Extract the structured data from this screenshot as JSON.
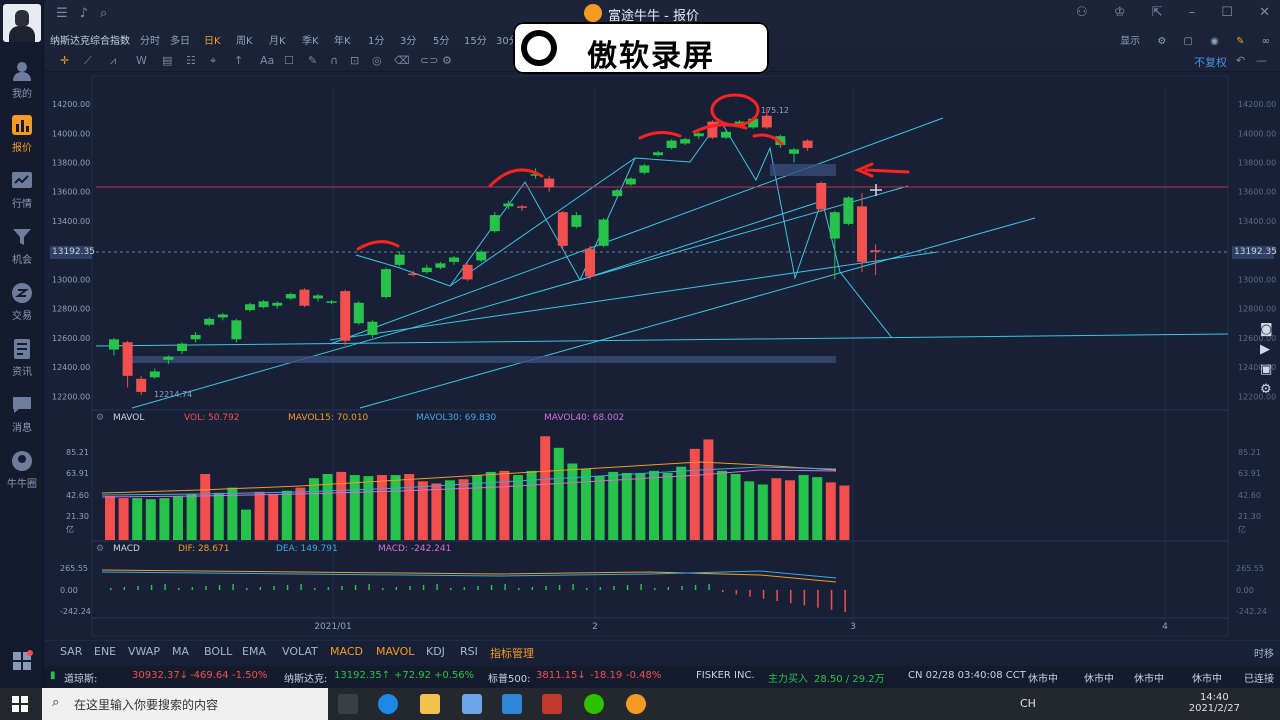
{
  "window": {
    "title": "富途牛牛 - 报价"
  },
  "sidebar": {
    "items": [
      {
        "label": "我的"
      },
      {
        "label": "报价"
      },
      {
        "label": "行情"
      },
      {
        "label": "机会"
      },
      {
        "label": "交易"
      },
      {
        "label": "资讯"
      },
      {
        "label": "消息"
      },
      {
        "label": "牛牛圈"
      }
    ]
  },
  "instrument": "纳斯达克综合指数",
  "periods": [
    "分时",
    "多日",
    "日K",
    "周K",
    "月K",
    "季K",
    "年K",
    "1分",
    "3分",
    "5分",
    "15分",
    "30分"
  ],
  "active_period": "日K",
  "view_options": {
    "display": "显示",
    "adjust": "不复权"
  },
  "watermark": "傲软录屏",
  "colors": {
    "up": "#26c24b",
    "down": "#f24f4f",
    "accent": "#f59a23",
    "trend": "#3ec3df",
    "annotation": "#ff2222"
  },
  "price_chart": {
    "y_ticks": [
      "14200.00",
      "14000.00",
      "13800.00",
      "13600.00",
      "13400.00",
      "13200.00",
      "13000.00",
      "12800.00",
      "12600.00",
      "12400.00",
      "12200.00"
    ],
    "current_price": "13192.35",
    "high_label": "175.12",
    "low_label": "12214.74"
  },
  "volume_panel": {
    "indicator": "MAVOL",
    "vol": "VOL: 50.792",
    "ma15": "MAVOL15: 70.010",
    "ma30": "MAVOL30: 69.830",
    "ma40": "MAVOL40: 68.002",
    "y_ticks": [
      "85.21",
      "63.91",
      "42.60",
      "21.30",
      "亿"
    ]
  },
  "macd_panel": {
    "indicator": "MACD",
    "dif": "DIF: 28.671",
    "dea": "DEA: 149.791",
    "macd": "MACD: -242.241",
    "y_ticks": [
      "265.55",
      "0.00",
      "-242.24"
    ]
  },
  "x_axis": [
    "2021/01",
    "2",
    "3",
    "4"
  ],
  "chart_data": {
    "type": "candlestick",
    "title": "纳斯达克综合指数",
    "candles": [
      {
        "o": 12520,
        "c": 12590,
        "h": 12600,
        "l": 12480
      },
      {
        "o": 12570,
        "c": 12340,
        "h": 12580,
        "l": 12260
      },
      {
        "o": 12320,
        "c": 12230,
        "h": 12340,
        "l": 12210
      },
      {
        "o": 12330,
        "c": 12370,
        "h": 12390,
        "l": 12320
      },
      {
        "o": 12450,
        "c": 12470,
        "h": 12480,
        "l": 12420
      },
      {
        "o": 12510,
        "c": 12560,
        "h": 12570,
        "l": 12490
      },
      {
        "o": 12590,
        "c": 12620,
        "h": 12640,
        "l": 12570
      },
      {
        "o": 12690,
        "c": 12730,
        "h": 12740,
        "l": 12680
      },
      {
        "o": 12740,
        "c": 12760,
        "h": 12770,
        "l": 12720
      },
      {
        "o": 12590,
        "c": 12720,
        "h": 12730,
        "l": 12570
      },
      {
        "o": 12790,
        "c": 12830,
        "h": 12840,
        "l": 12780
      },
      {
        "o": 12810,
        "c": 12850,
        "h": 12860,
        "l": 12800
      },
      {
        "o": 12820,
        "c": 12840,
        "h": 12850,
        "l": 12800
      },
      {
        "o": 12870,
        "c": 12900,
        "h": 12910,
        "l": 12860
      },
      {
        "o": 12930,
        "c": 12820,
        "h": 12940,
        "l": 12810
      },
      {
        "o": 12870,
        "c": 12890,
        "h": 12900,
        "l": 12850
      },
      {
        "o": 12840,
        "c": 12850,
        "h": 12860,
        "l": 12830
      },
      {
        "o": 12920,
        "c": 12580,
        "h": 12930,
        "l": 12550
      },
      {
        "o": 12700,
        "c": 12840,
        "h": 12850,
        "l": 12690
      },
      {
        "o": 12620,
        "c": 12710,
        "h": 12720,
        "l": 12600
      },
      {
        "o": 12880,
        "c": 13070,
        "h": 13080,
        "l": 12870
      },
      {
        "o": 13100,
        "c": 13170,
        "h": 13190,
        "l": 13090
      },
      {
        "o": 13040,
        "c": 13030,
        "h": 13060,
        "l": 13020
      },
      {
        "o": 13050,
        "c": 13080,
        "h": 13100,
        "l": 13040
      },
      {
        "o": 13080,
        "c": 13110,
        "h": 13120,
        "l": 13070
      },
      {
        "o": 13120,
        "c": 13150,
        "h": 13160,
        "l": 13100
      },
      {
        "o": 13100,
        "c": 13000,
        "h": 13110,
        "l": 12990
      },
      {
        "o": 13130,
        "c": 13190,
        "h": 13200,
        "l": 13120
      },
      {
        "o": 13330,
        "c": 13440,
        "h": 13460,
        "l": 13320
      },
      {
        "o": 13500,
        "c": 13520,
        "h": 13540,
        "l": 13480
      },
      {
        "o": 13500,
        "c": 13490,
        "h": 13510,
        "l": 13470
      },
      {
        "o": 13710,
        "c": 13720,
        "h": 13760,
        "l": 13690
      },
      {
        "o": 13690,
        "c": 13630,
        "h": 13710,
        "l": 13600
      },
      {
        "o": 13460,
        "c": 13230,
        "h": 13470,
        "l": 13210
      },
      {
        "o": 13360,
        "c": 13440,
        "h": 13460,
        "l": 13350
      },
      {
        "o": 13210,
        "c": 13020,
        "h": 13230,
        "l": 13000
      },
      {
        "o": 13230,
        "c": 13410,
        "h": 13420,
        "l": 13220
      },
      {
        "o": 13570,
        "c": 13610,
        "h": 13620,
        "l": 13560
      },
      {
        "o": 13650,
        "c": 13690,
        "h": 13700,
        "l": 13640
      },
      {
        "o": 13730,
        "c": 13780,
        "h": 13790,
        "l": 13720
      },
      {
        "o": 13850,
        "c": 13870,
        "h": 13880,
        "l": 13840
      },
      {
        "o": 13900,
        "c": 13950,
        "h": 13960,
        "l": 13890
      },
      {
        "o": 13930,
        "c": 13960,
        "h": 13970,
        "l": 13920
      },
      {
        "o": 13980,
        "c": 14000,
        "h": 14010,
        "l": 13960
      },
      {
        "o": 14080,
        "c": 13970,
        "h": 14090,
        "l": 13960
      },
      {
        "o": 13970,
        "c": 14010,
        "h": 14020,
        "l": 13960
      },
      {
        "o": 14050,
        "c": 14080,
        "h": 14090,
        "l": 14040
      },
      {
        "o": 14040,
        "c": 14100,
        "h": 14110,
        "l": 14030
      },
      {
        "o": 14120,
        "c": 14040,
        "h": 14175,
        "l": 14030
      },
      {
        "o": 13920,
        "c": 13980,
        "h": 13990,
        "l": 13900
      },
      {
        "o": 13860,
        "c": 13890,
        "h": 13900,
        "l": 13800
      },
      {
        "o": 13950,
        "c": 13900,
        "h": 13960,
        "l": 13880
      },
      {
        "o": 13660,
        "c": 13480,
        "h": 13670,
        "l": 13460
      },
      {
        "o": 13280,
        "c": 13460,
        "h": 13470,
        "l": 13000
      },
      {
        "o": 13380,
        "c": 13560,
        "h": 13570,
        "l": 13370
      },
      {
        "o": 13500,
        "c": 13120,
        "h": 13590,
        "l": 13050
      },
      {
        "o": 13200,
        "c": 13192,
        "h": 13240,
        "l": 13030
      }
    ],
    "volume": [
      {
        "v": 42,
        "up": false
      },
      {
        "v": 40,
        "up": false
      },
      {
        "v": 40,
        "up": true
      },
      {
        "v": 39,
        "up": true
      },
      {
        "v": 40,
        "up": true
      },
      {
        "v": 42,
        "up": true
      },
      {
        "v": 44,
        "up": true
      },
      {
        "v": 63,
        "up": false
      },
      {
        "v": 45,
        "up": true
      },
      {
        "v": 50,
        "up": true
      },
      {
        "v": 29,
        "up": true
      },
      {
        "v": 46,
        "up": false
      },
      {
        "v": 44,
        "up": false
      },
      {
        "v": 47,
        "up": true
      },
      {
        "v": 50,
        "up": false
      },
      {
        "v": 59,
        "up": true
      },
      {
        "v": 63,
        "up": true
      },
      {
        "v": 65,
        "up": false
      },
      {
        "v": 62,
        "up": true
      },
      {
        "v": 61,
        "up": true
      },
      {
        "v": 62,
        "up": false
      },
      {
        "v": 62,
        "up": true
      },
      {
        "v": 63,
        "up": false
      },
      {
        "v": 56,
        "up": false
      },
      {
        "v": 54,
        "up": false
      },
      {
        "v": 57,
        "up": true
      },
      {
        "v": 58,
        "up": false
      },
      {
        "v": 62,
        "up": true
      },
      {
        "v": 65,
        "up": true
      },
      {
        "v": 66,
        "up": false
      },
      {
        "v": 62,
        "up": true
      },
      {
        "v": 66,
        "up": true
      },
      {
        "v": 99,
        "up": false
      },
      {
        "v": 88,
        "up": true
      },
      {
        "v": 73,
        "up": true
      },
      {
        "v": 68,
        "up": true
      },
      {
        "v": 61,
        "up": true
      },
      {
        "v": 65,
        "up": true
      },
      {
        "v": 64,
        "up": true
      },
      {
        "v": 64,
        "up": true
      },
      {
        "v": 66,
        "up": true
      },
      {
        "v": 64,
        "up": true
      },
      {
        "v": 70,
        "up": true
      },
      {
        "v": 87,
        "up": false
      },
      {
        "v": 96,
        "up": false
      },
      {
        "v": 66,
        "up": true
      },
      {
        "v": 63,
        "up": true
      },
      {
        "v": 56,
        "up": true
      },
      {
        "v": 53,
        "up": true
      },
      {
        "v": 59,
        "up": false
      },
      {
        "v": 57,
        "up": false
      },
      {
        "v": 62,
        "up": true
      },
      {
        "v": 60,
        "up": true
      },
      {
        "v": 55,
        "up": false
      },
      {
        "v": 52,
        "up": false
      }
    ],
    "y_range": [
      12120,
      14310
    ],
    "x_labels": [
      "2021/01",
      "2",
      "3",
      "4"
    ]
  },
  "bottom_indicators": [
    "SAR",
    "ENE",
    "VWAP",
    "MA",
    "BOLL",
    "EMA",
    "VOLAT",
    "MACD",
    "MAVOL",
    "KDJ",
    "RSI",
    "指标管理"
  ],
  "bottom_right": "时移",
  "ticker": {
    "dow_name": "道琼斯:",
    "dow_value": "30932.37↓",
    "dow_change": "-469.64",
    "dow_pct": "-1.50%",
    "nasdaq_name": "纳斯达克:",
    "nasdaq_value": "13192.35↑",
    "nasdaq_change": "+72.92",
    "nasdaq_pct": "+0.56%",
    "sp_name": "标普500:",
    "sp_value": "3811.15↓",
    "sp_change": "-18.19",
    "sp_pct": "-0.48%",
    "news": "FISKER INC.",
    "flow_label": "主力买入",
    "flow_value": "28.50 / 29.2万",
    "clock": "CN 02/28 03:40:08 CCT",
    "markets": [
      "休市中",
      "休市中",
      "休市中",
      "休市中"
    ],
    "connection": "已连接"
  },
  "taskbar": {
    "search_placeholder": "在这里输入你要搜索的内容",
    "lang": "CH",
    "time": "14:40",
    "date": "2021/2/27"
  }
}
